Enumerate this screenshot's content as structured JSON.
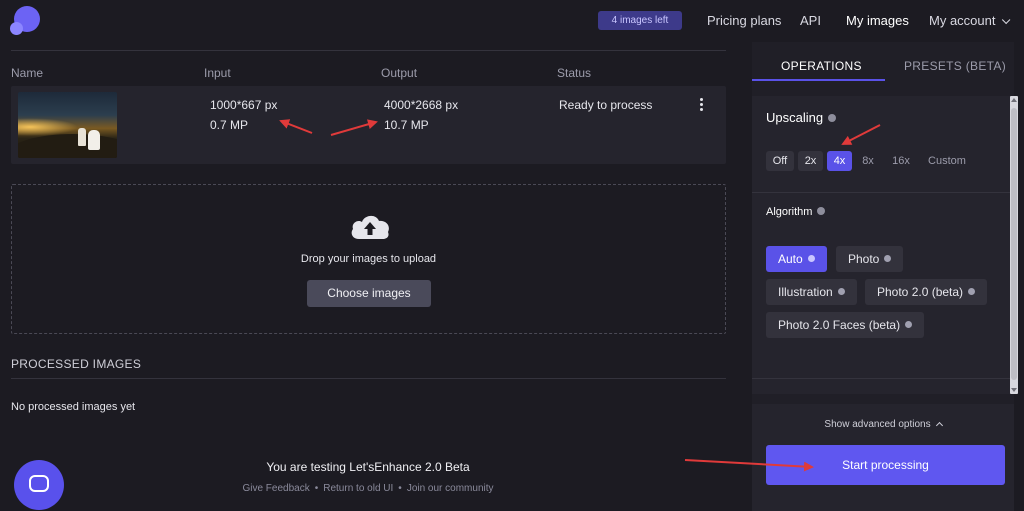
{
  "header": {
    "badge": "4 images left",
    "nav": [
      "Pricing plans",
      "API",
      "My images",
      "My account"
    ]
  },
  "table": {
    "columns": [
      "Name",
      "Input",
      "Output",
      "Status"
    ],
    "row": {
      "input_size": "1000*667 px",
      "input_mp": "0.7 MP",
      "output_size": "4000*2668 px",
      "output_mp": "10.7 MP",
      "status": "Ready to process"
    }
  },
  "upload": {
    "text": "Drop your images to upload",
    "button": "Choose images"
  },
  "processed": {
    "title": "PROCESSED IMAGES",
    "empty": "No processed images yet"
  },
  "footer": {
    "beta": "You are testing Let'sEnhance 2.0 Beta",
    "links": [
      "Give Feedback",
      "Return to old UI",
      "Join our community"
    ],
    "separator": "•"
  },
  "panel": {
    "tabs": [
      "OPERATIONS",
      "PRESETS (BETA)"
    ],
    "upscaling": {
      "title": "Upscaling",
      "options": [
        "Off",
        "2x",
        "4x",
        "8x",
        "16x",
        "Custom"
      ],
      "selected": "4x"
    },
    "algorithm": {
      "title": "Algorithm",
      "options": [
        "Auto",
        "Photo",
        "Illustration",
        "Photo 2.0 (beta)",
        "Photo 2.0 Faces (beta)"
      ],
      "selected": "Auto"
    },
    "advanced": "Show advanced options",
    "start": "Start processing"
  },
  "colors": {
    "background": "#1c1b22",
    "accent": "#5a52e8",
    "annotation_arrow": "#e03a3a"
  }
}
